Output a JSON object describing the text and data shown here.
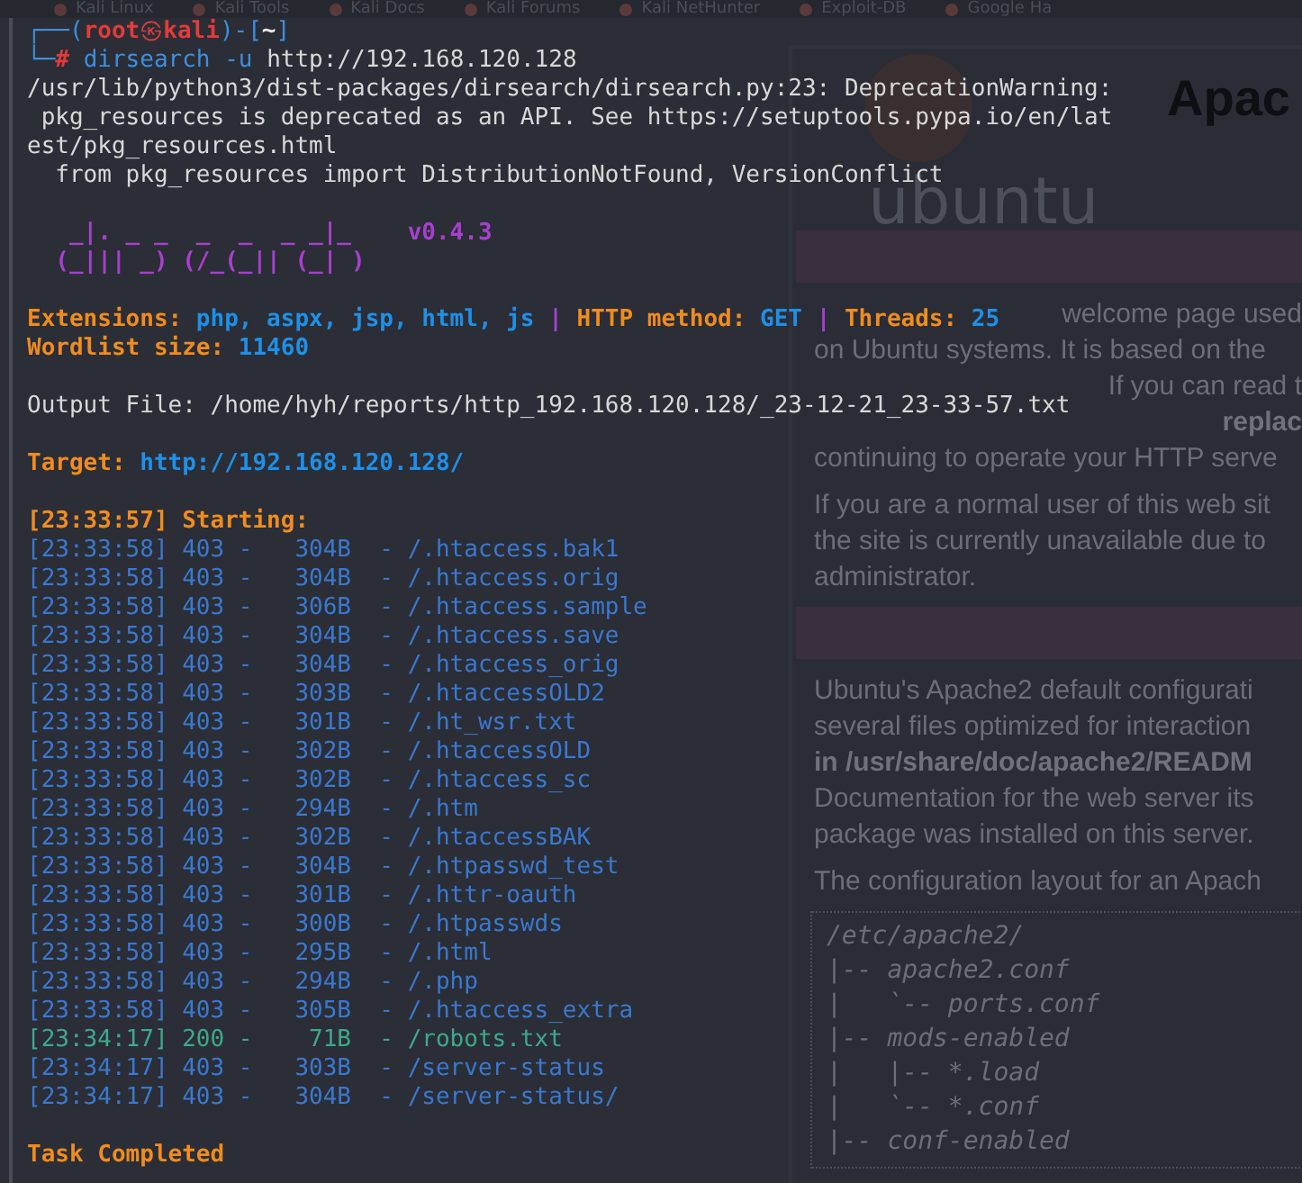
{
  "bookmarks": [
    "Kali Linux",
    "Kali Tools",
    "Kali Docs",
    "Kali Forums",
    "Kali NetHunter",
    "Exploit-DB",
    "Google Ha"
  ],
  "browser_page": {
    "heading": "Apac",
    "logo_text": "ubuntu",
    "sections": [
      {
        "kind": "band"
      },
      {
        "kind": "paragraph",
        "lines": [
          {
            "text": "welcome page used",
            "covered": true
          },
          {
            "text": "on Ubuntu systems. It is based on the",
            "covered": false
          },
          {
            "text": "If you can read t",
            "covered": true
          },
          {
            "text": "**replac**",
            "covered": true
          },
          {
            "text": "continuing to operate your HTTP serve",
            "covered": false
          }
        ]
      },
      {
        "kind": "paragraph",
        "lines": [
          {
            "text": "If you are a normal user of this web sit",
            "covered": false
          },
          {
            "text": "the site is currently unavailable due to",
            "covered": false
          },
          {
            "text": "administrator.",
            "covered": false
          }
        ]
      },
      {
        "kind": "band"
      },
      {
        "kind": "paragraph",
        "lines": [
          {
            "text": "Ubuntu's Apache2 default configurati",
            "covered": false
          },
          {
            "text": "several files optimized for interaction",
            "covered": false
          },
          {
            "text": "**in /usr/share/doc/apache2/READM**",
            "covered": false
          },
          {
            "text": "Documentation for the web server its",
            "covered": false
          },
          {
            "text": "package was installed on this server.",
            "covered": false
          }
        ]
      },
      {
        "kind": "paragraph",
        "lines": [
          {
            "text": "The configuration layout for an Apach",
            "covered": false
          }
        ]
      },
      {
        "kind": "code",
        "lines": [
          "/etc/apache2/",
          "|-- apache2.conf",
          "|   `-- ports.conf",
          "|-- mods-enabled",
          "|   |-- *.load",
          "|   `-- *.conf",
          "|-- conf-enabled"
        ]
      }
    ]
  },
  "terminal": {
    "prompt": {
      "corner_top": "┌──",
      "open": "(",
      "user": "root",
      "at": "㉿",
      "host": "kali",
      "close": ")-[",
      "cwd": "~",
      "end": "]",
      "corner_bottom": "└─",
      "sign": "#",
      "command": "dirsearch",
      "flag": "-u",
      "argument": "http://192.168.120.128"
    },
    "warning_lines": [
      "/usr/lib/python3/dist-packages/dirsearch/dirsearch.py:23: DeprecationWarning:",
      " pkg_resources is deprecated as an API. See https://setuptools.pypa.io/en/lat",
      "est/pkg_resources.html",
      "  from pkg_resources import DistributionNotFound, VersionConflict"
    ],
    "banner": {
      "art": [
        "  _|. _ _  _  _  _ _|_",
        " (_||| _) (/_(_|| (_| )"
      ],
      "version": "v0.4.3"
    },
    "config": [
      {
        "label": "Extensions:",
        "value": "php, aspx, jsp, html, js"
      },
      {
        "label": "HTTP method:",
        "value": "GET"
      },
      {
        "label": "Threads:",
        "value": "25"
      }
    ],
    "separators": [
      "|",
      "|"
    ],
    "wordlist": {
      "label": "Wordlist size:",
      "value": "11460"
    },
    "output_file": "Output File: /home/hyh/reports/http_192.168.120.128/_23-12-21_23-33-57.txt",
    "target": {
      "label": "Target:",
      "value": "http://192.168.120.128/"
    },
    "starting": "[23:33:57] Starting:",
    "results": [
      {
        "line": "[23:33:58] 403 -   304B  - /.htaccess.bak1",
        "color": "#3a78d0"
      },
      {
        "line": "[23:33:58] 403 -   304B  - /.htaccess.orig",
        "color": "#3a78d0"
      },
      {
        "line": "[23:33:58] 403 -   306B  - /.htaccess.sample",
        "color": "#3a78d0"
      },
      {
        "line": "[23:33:58] 403 -   304B  - /.htaccess.save",
        "color": "#3a78d0"
      },
      {
        "line": "[23:33:58] 403 -   304B  - /.htaccess_orig",
        "color": "#3a78d0"
      },
      {
        "line": "[23:33:58] 403 -   303B  - /.htaccessOLD2",
        "color": "#3a78d0"
      },
      {
        "line": "[23:33:58] 403 -   301B  - /.ht_wsr.txt",
        "color": "#3a78d0"
      },
      {
        "line": "[23:33:58] 403 -   302B  - /.htaccessOLD",
        "color": "#3a78d0"
      },
      {
        "line": "[23:33:58] 403 -   302B  - /.htaccess_sc",
        "color": "#3a78d0"
      },
      {
        "line": "[23:33:58] 403 -   294B  - /.htm",
        "color": "#3a78d0"
      },
      {
        "line": "[23:33:58] 403 -   302B  - /.htaccessBAK",
        "color": "#3a78d0"
      },
      {
        "line": "[23:33:58] 403 -   304B  - /.htpasswd_test",
        "color": "#3a78d0"
      },
      {
        "line": "[23:33:58] 403 -   301B  - /.httr-oauth",
        "color": "#3a78d0"
      },
      {
        "line": "[23:33:58] 403 -   300B  - /.htpasswds",
        "color": "#3a78d0"
      },
      {
        "line": "[23:33:58] 403 -   295B  - /.html",
        "color": "#3a78d0"
      },
      {
        "line": "[23:33:58] 403 -   294B  - /.php",
        "color": "#3a78d0"
      },
      {
        "line": "[23:33:58] 403 -   305B  - /.htaccess_extra",
        "color": "#3a78d0"
      },
      {
        "line": "[23:34:17] 200 -    71B  - /robots.txt",
        "color": "#3fa88a"
      },
      {
        "line": "[23:34:17] 403 -   303B  - /server-status",
        "color": "#3a78d0"
      },
      {
        "line": "[23:34:17] 403 -   304B  - /server-status/",
        "color": "#3a78d0"
      }
    ],
    "completed": "Task Completed"
  }
}
